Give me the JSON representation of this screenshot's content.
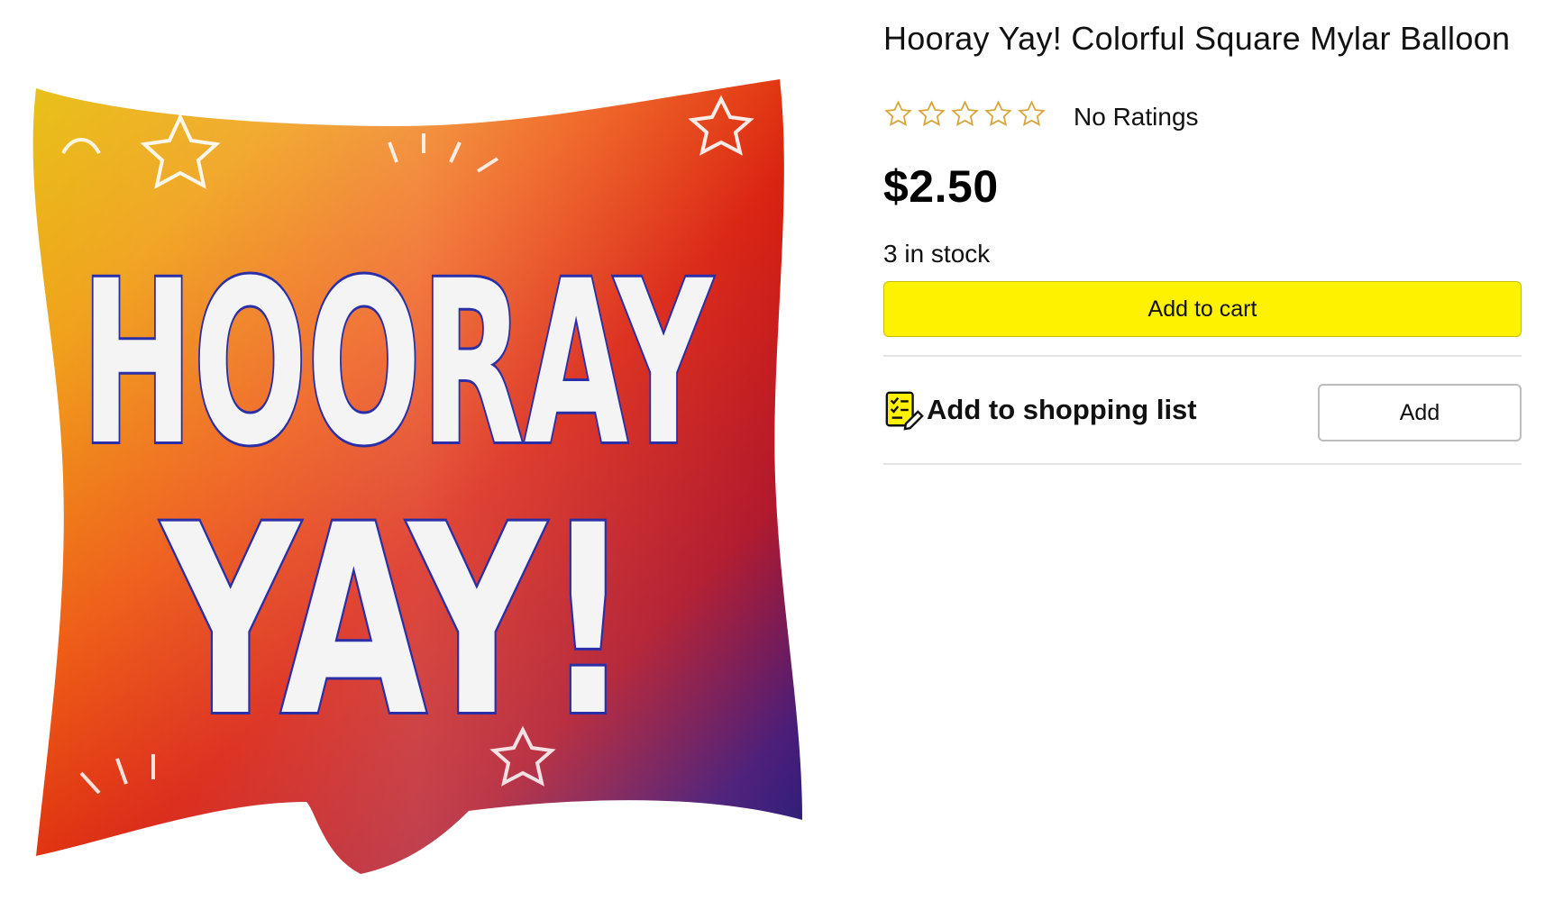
{
  "product": {
    "title": "Hooray Yay! Colorful Square Mylar Balloon",
    "rating_label": "No Ratings",
    "rating_value": 0,
    "rating_max": 5,
    "price": "$2.50",
    "stock": "3 in stock",
    "add_to_cart_label": "Add to cart",
    "image_text_line1": "HOORAY",
    "image_text_line2": "YAY!"
  },
  "shopping_list": {
    "label": "Add to shopping list",
    "button_label": "Add",
    "icon": "shopping-list-icon"
  },
  "colors": {
    "cart_button": "#fff200",
    "star_outline": "#d9a53a",
    "divider": "#e3e3e3"
  }
}
